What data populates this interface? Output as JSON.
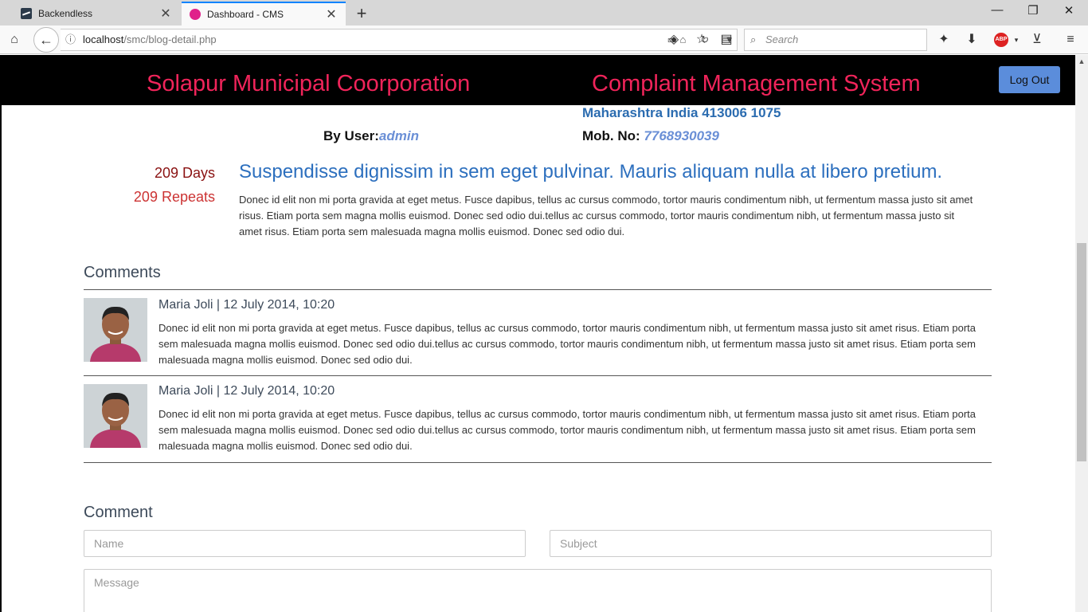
{
  "browser": {
    "tabs": [
      {
        "title": "Backendless",
        "active": false
      },
      {
        "title": "Dashboard - CMS",
        "active": true
      }
    ],
    "url_host": "localhost",
    "url_path": "/smc/blog-detail.php",
    "search_placeholder": "Search",
    "abp_label": "ABP"
  },
  "header": {
    "brand_left": "Solapur Municipal Coorporation",
    "brand_right": "Complaint Management System",
    "logout_label": "Log Out"
  },
  "info": {
    "address": "Maharashtra India 413006 1075",
    "by_user_label": "By User:",
    "by_user_value": "admin",
    "mob_label": "Mob. No: ",
    "mob_value": "7768930039"
  },
  "post": {
    "days": "209 Days",
    "repeats": "209 Repeats",
    "title": "Suspendisse dignissim in sem eget pulvinar. Mauris aliquam nulla at libero pretium.",
    "body": "Donec id elit non mi porta gravida at eget metus. Fusce dapibus, tellus ac cursus commodo, tortor mauris condimentum nibh, ut fermentum massa justo sit amet risus. Etiam porta sem magna mollis euismod. Donec sed odio dui.tellus ac cursus commodo, tortor mauris condimentum nibh, ut fermentum massa justo sit amet risus. Etiam porta sem malesuada magna mollis euismod. Donec sed odio dui."
  },
  "comments": {
    "heading": "Comments",
    "items": [
      {
        "meta": "Maria Joli | 12 July 2014, 10:20",
        "text": "Donec id elit non mi porta gravida at eget metus. Fusce dapibus, tellus ac cursus commodo, tortor mauris condimentum nibh, ut fermentum massa justo sit amet risus. Etiam porta sem malesuada magna mollis euismod. Donec sed odio dui.tellus ac cursus commodo, tortor mauris condimentum nibh, ut fermentum massa justo sit amet risus. Etiam porta sem malesuada magna mollis euismod. Donec sed odio dui."
      },
      {
        "meta": "Maria Joli | 12 July 2014, 10:20",
        "text": "Donec id elit non mi porta gravida at eget metus. Fusce dapibus, tellus ac cursus commodo, tortor mauris condimentum nibh, ut fermentum massa justo sit amet risus. Etiam porta sem malesuada magna mollis euismod. Donec sed odio dui.tellus ac cursus commodo, tortor mauris condimentum nibh, ut fermentum massa justo sit amet risus. Etiam porta sem malesuada magna mollis euismod. Donec sed odio dui."
      }
    ]
  },
  "form": {
    "heading": "Comment",
    "name_placeholder": "Name",
    "subject_placeholder": "Subject",
    "message_placeholder": "Message"
  },
  "colors": {
    "brand": "#f0245a",
    "link_blue": "#2c6fbe",
    "logout_bg": "#5b8ddb"
  }
}
